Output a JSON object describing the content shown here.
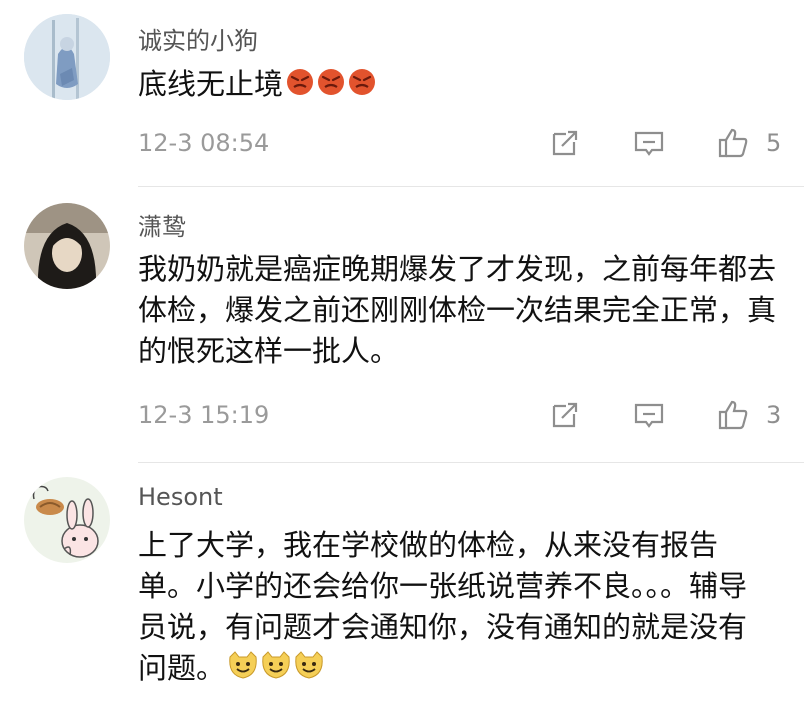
{
  "comments": [
    {
      "username": "诚实的小狗",
      "text": "底线无止境",
      "emoji": "angry-face-emoji",
      "emoji_count": 3,
      "timestamp": "12-3 08:54",
      "likes": "5"
    },
    {
      "username": "潇鸷",
      "text": "我奶奶就是癌症晚期爆发了才发现，之前每年都去体检，爆发之前还刚刚体检一次结果完全正常，真的恨死这样一批人。",
      "timestamp": "12-3 15:19",
      "likes": "3"
    },
    {
      "username": "Hesont",
      "text": "上了大学，我在学校做的体检，从来没有报告单。小学的还会给你一张纸说营养不良。。。辅导员说，有问题才会通知你，没有通知的就是没有问题。",
      "emoji": "grinning-face-emoji",
      "emoji_count": 3
    }
  ],
  "colors": {
    "username": "#555555",
    "timestamp": "#9a9a9a",
    "icon": "#8e8e8e",
    "divider": "#e6e6e6",
    "angry_emoji": "#e2532d",
    "smile_emoji": "#f5cf57"
  }
}
